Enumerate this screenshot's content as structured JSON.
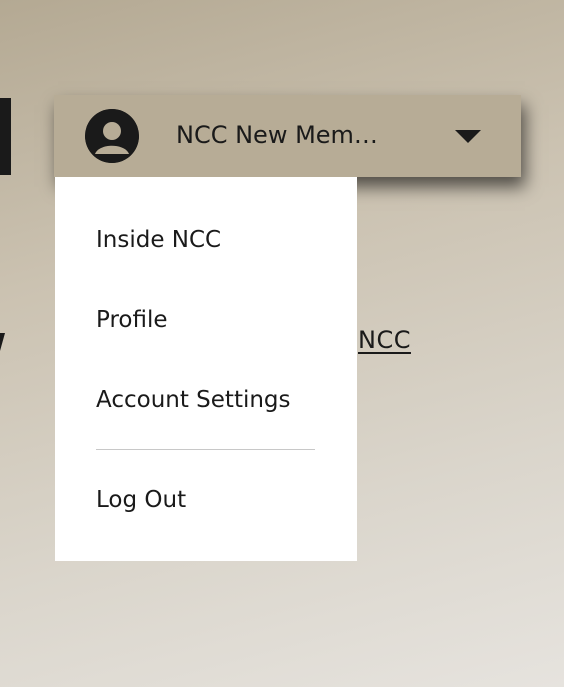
{
  "account_menu": {
    "user_name": "NCC New Mem…",
    "items": [
      {
        "label": "Inside NCC"
      },
      {
        "label": "Profile"
      },
      {
        "label": "Account Settings"
      },
      {
        "label": "Log Out"
      }
    ]
  },
  "background": {
    "link_text": "NCC"
  },
  "icons": {
    "avatar": "user-avatar-icon",
    "caret": "caret-down-icon"
  },
  "colors": {
    "button_bg": "#b7ac96",
    "menu_bg": "#ffffff",
    "text": "#1a1a1a"
  }
}
